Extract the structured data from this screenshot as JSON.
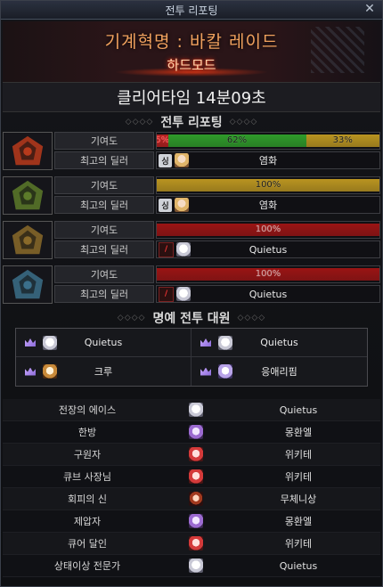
{
  "window": {
    "title": "전투 리포팅",
    "close_glyph": "✕"
  },
  "raid": {
    "title": "기계혁명 : 바칼 레이드",
    "difficulty": "하드모드"
  },
  "clear_time": "클리어타임  14분09초",
  "report_section": {
    "title": "전투 리포팅"
  },
  "labels": {
    "contribution": "기여도",
    "best_dealer": "최고의 딜러"
  },
  "phases": [
    {
      "boss_icon": "fire-boss-icon",
      "boss_color": "#b83a1c",
      "contribution_segments": [
        {
          "label": "5%",
          "percent": 5,
          "color": "#b3201f",
          "text_color": "#ff5050"
        },
        {
          "label": "62%",
          "percent": 62,
          "color": "#2f9b2a",
          "text_color": "#1a1a1a"
        },
        {
          "label": "33%",
          "percent": 33,
          "color": "#b99420",
          "text_color": "#1a1a1a"
        }
      ],
      "dealer_badge": "싱",
      "dealer_badge_style": "s",
      "dealer_avatar": "blonde",
      "best_dealer": "염화"
    },
    {
      "boss_icon": "leaf-boss-icon",
      "boss_color": "#5c7a2a",
      "contribution_segments": [
        {
          "label": "100%",
          "percent": 100,
          "color": "#b99420",
          "text_color": "#1a1a1a"
        }
      ],
      "dealer_badge": "싱",
      "dealer_badge_style": "s",
      "dealer_avatar": "blonde",
      "best_dealer": "염화"
    },
    {
      "boss_icon": "gold-boss-icon",
      "boss_color": "#8a6a2a",
      "contribution_segments": [
        {
          "label": "100%",
          "percent": 100,
          "color": "#9a1414",
          "text_color": "#d0a0a0"
        }
      ],
      "dealer_badge": "/",
      "dealer_badge_style": "r",
      "dealer_avatar": "white",
      "best_dealer": "Quietus"
    },
    {
      "boss_icon": "ice-boss-icon",
      "boss_color": "#3b6f8a",
      "contribution_segments": [
        {
          "label": "100%",
          "percent": 100,
          "color": "#9a1414",
          "text_color": "#d0a0a0"
        }
      ],
      "dealer_badge": "/",
      "dealer_badge_style": "r",
      "dealer_avatar": "white",
      "best_dealer": "Quietus"
    }
  ],
  "honor_section": {
    "title": "명예 전투 대원"
  },
  "honor_members": [
    {
      "name": "Quietus",
      "avatar": "white"
    },
    {
      "name": "Quietus",
      "avatar": "white"
    },
    {
      "name": "크루",
      "avatar": "fox"
    },
    {
      "name": "응애리핌",
      "avatar": "lilac"
    }
  ],
  "titles": [
    {
      "title": "전장의 에이스",
      "player": "Quietus",
      "avatar": "white"
    },
    {
      "title": "한방",
      "player": "몽환엘",
      "avatar": "purple"
    },
    {
      "title": "구원자",
      "player": "위키테",
      "avatar": "red"
    },
    {
      "title": "큐브 사장님",
      "player": "위키테",
      "avatar": "red"
    },
    {
      "title": "회피의 신",
      "player": "무체니상",
      "avatar": "dark"
    },
    {
      "title": "제압자",
      "player": "몽환엘",
      "avatar": "purple"
    },
    {
      "title": "큐어 달인",
      "player": "위키테",
      "avatar": "red"
    },
    {
      "title": "상태이상 전문가",
      "player": "Quietus",
      "avatar": "white"
    }
  ]
}
